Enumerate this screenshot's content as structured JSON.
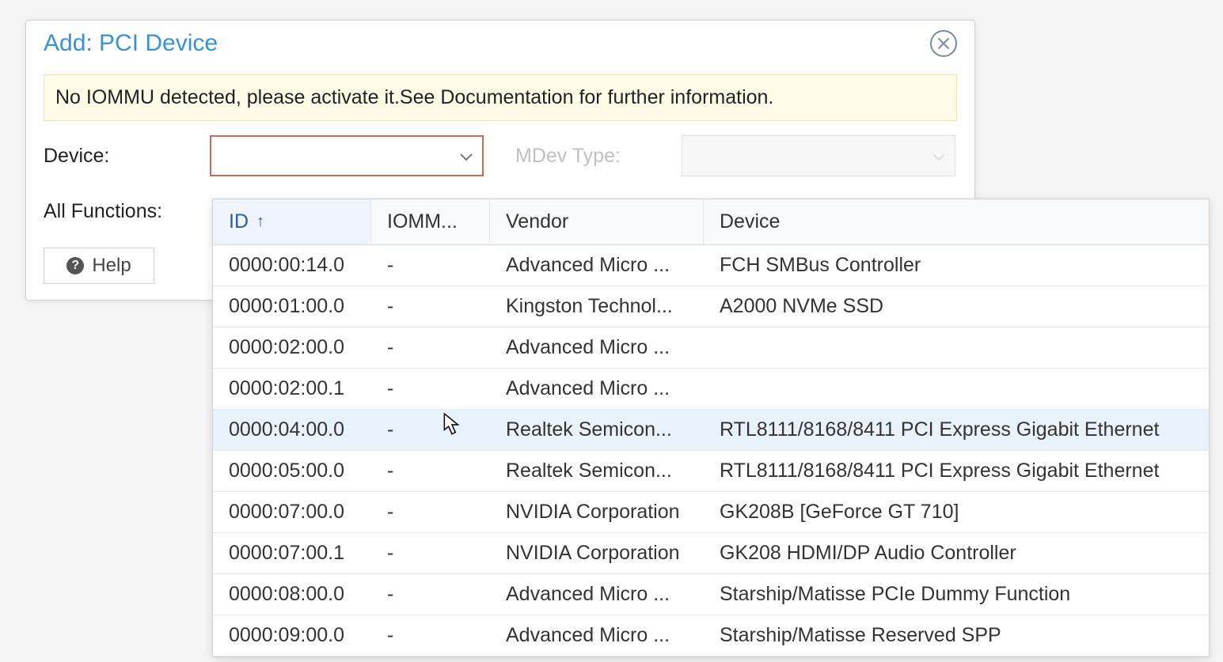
{
  "dialog": {
    "title": "Add: PCI Device",
    "warning": "No IOMMU detected, please activate it.See Documentation for further information.",
    "labels": {
      "device": "Device:",
      "all_functions": "All Functions:",
      "mdev_type": "MDev Type:"
    },
    "help_label": "Help"
  },
  "dropdown": {
    "headers": {
      "id": "ID",
      "iommu": "IOMM...",
      "vendor": "Vendor",
      "device": "Device"
    },
    "sort_indicator": "↑",
    "rows": [
      {
        "id": "0000:00:14.0",
        "iommu": "-",
        "vendor": "Advanced Micro ...",
        "device": "FCH SMBus Controller"
      },
      {
        "id": "0000:01:00.0",
        "iommu": "-",
        "vendor": "Kingston Technol...",
        "device": "A2000 NVMe SSD"
      },
      {
        "id": "0000:02:00.0",
        "iommu": "-",
        "vendor": "Advanced Micro ...",
        "device": ""
      },
      {
        "id": "0000:02:00.1",
        "iommu": "-",
        "vendor": "Advanced Micro ...",
        "device": ""
      },
      {
        "id": "0000:04:00.0",
        "iommu": "-",
        "vendor": "Realtek Semicon...",
        "device": "RTL8111/8168/8411 PCI Express Gigabit Ethernet"
      },
      {
        "id": "0000:05:00.0",
        "iommu": "-",
        "vendor": "Realtek Semicon...",
        "device": "RTL8111/8168/8411 PCI Express Gigabit Ethernet"
      },
      {
        "id": "0000:07:00.0",
        "iommu": "-",
        "vendor": "NVIDIA Corporation",
        "device": "GK208B [GeForce GT 710]"
      },
      {
        "id": "0000:07:00.1",
        "iommu": "-",
        "vendor": "NVIDIA Corporation",
        "device": "GK208 HDMI/DP Audio Controller"
      },
      {
        "id": "0000:08:00.0",
        "iommu": "-",
        "vendor": "Advanced Micro ...",
        "device": "Starship/Matisse PCIe Dummy Function"
      },
      {
        "id": "0000:09:00.0",
        "iommu": "-",
        "vendor": "Advanced Micro ...",
        "device": "Starship/Matisse Reserved SPP"
      }
    ],
    "hover_index": 4
  }
}
